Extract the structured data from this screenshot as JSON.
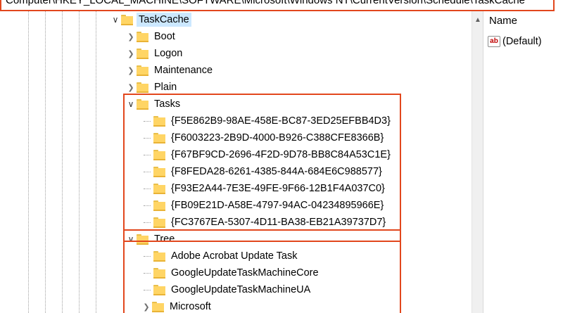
{
  "address_bar": {
    "path": "Computer\\HKEY_LOCAL_MACHINE\\SOFTWARE\\Microsoft\\Windows NT\\CurrentVersion\\Schedule\\TaskCache"
  },
  "tree": {
    "selected": "TaskCache",
    "taskcache_label": "TaskCache",
    "children": [
      {
        "label": "Boot",
        "expander": "collapsed"
      },
      {
        "label": "Logon",
        "expander": "collapsed"
      },
      {
        "label": "Maintenance",
        "expander": "collapsed"
      },
      {
        "label": "Plain",
        "expander": "collapsed"
      }
    ],
    "tasks": {
      "label": "Tasks",
      "expander": "expanded",
      "items": [
        "{F5E862B9-98AE-458E-BC87-3ED25EFBB4D3}",
        "{F6003223-2B9D-4000-B926-C388CFE8366B}",
        "{F67BF9CD-2696-4F2D-9D78-BB8C84A53C1E}",
        "{F8FEDA28-6261-4385-844A-684E6C988577}",
        "{F93E2A44-7E3E-49FE-9F66-12B1F4A037C0}",
        "{FB09E21D-A58E-4797-94AC-04234895966E}",
        "{FC3767EA-5307-4D11-BA38-EB21A39737D7}"
      ]
    },
    "tree_node": {
      "label": "Tree",
      "expander": "expanded",
      "items": [
        {
          "label": "Adobe Acrobat Update Task",
          "expander": "none"
        },
        {
          "label": "GoogleUpdateTaskMachineCore",
          "expander": "none"
        },
        {
          "label": "GoogleUpdateTaskMachineUA",
          "expander": "none"
        },
        {
          "label": "Microsoft",
          "expander": "collapsed"
        }
      ]
    }
  },
  "values_pane": {
    "column_header": "Name",
    "rows": [
      {
        "icon": "string-value-icon",
        "icon_text": "ab",
        "name": "(Default)"
      }
    ]
  },
  "colors": {
    "highlight_border": "#e2471d",
    "selection_background": "#cce8ff",
    "folder_yellow": "#ffd565"
  }
}
